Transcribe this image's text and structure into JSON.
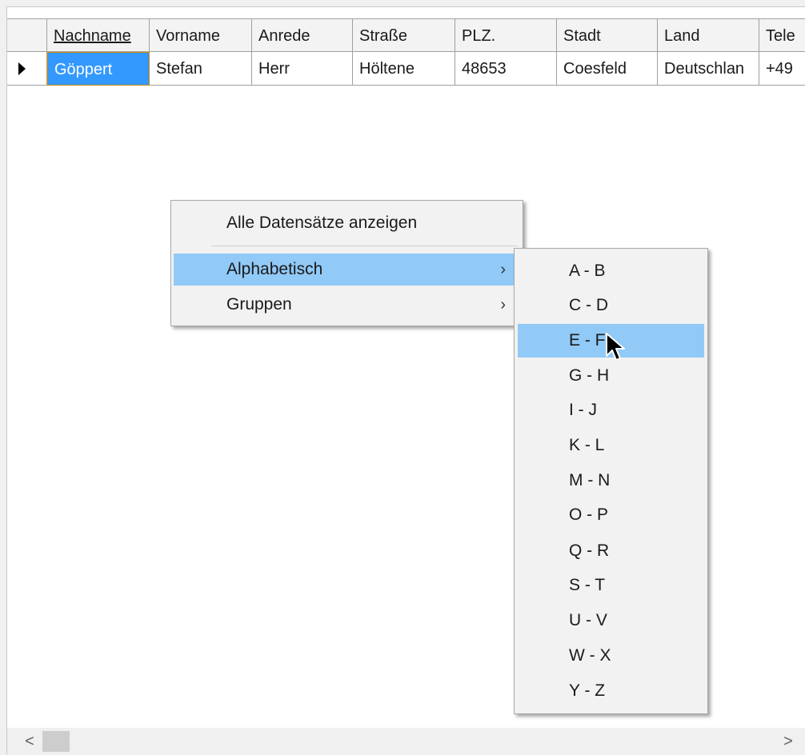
{
  "grid": {
    "columns": [
      "Nachname",
      "Vorname",
      "Anrede",
      "Straße",
      "PLZ.",
      "Stadt",
      "Land",
      "Tele"
    ],
    "row": [
      "Göppert",
      "Stefan",
      "Herr",
      "Höltene",
      "48653",
      "Coesfeld",
      "Deutschlan",
      "+49"
    ]
  },
  "context_menu": {
    "show_all": "Alle Datensätze anzeigen",
    "alphabetical": "Alphabetisch",
    "groups": "Gruppen",
    "submenu_arrow": "›"
  },
  "submenu": {
    "items": [
      "A - B",
      "C - D",
      "E - F",
      "G - H",
      "I - J",
      "K - L",
      "M - N",
      "O - P",
      "Q - R",
      "S - T",
      "U - V",
      "W - X",
      "Y - Z"
    ]
  },
  "scrollbar": {
    "left_arrow": "<",
    "right_arrow": ">"
  },
  "colors": {
    "selection": "#3399ff",
    "menu_highlight": "#91c9f7",
    "focus_border": "#d48a00"
  },
  "icons": {
    "row_indicator": "row-pointer-icon",
    "cursor": "mouse-arrow-icon"
  }
}
